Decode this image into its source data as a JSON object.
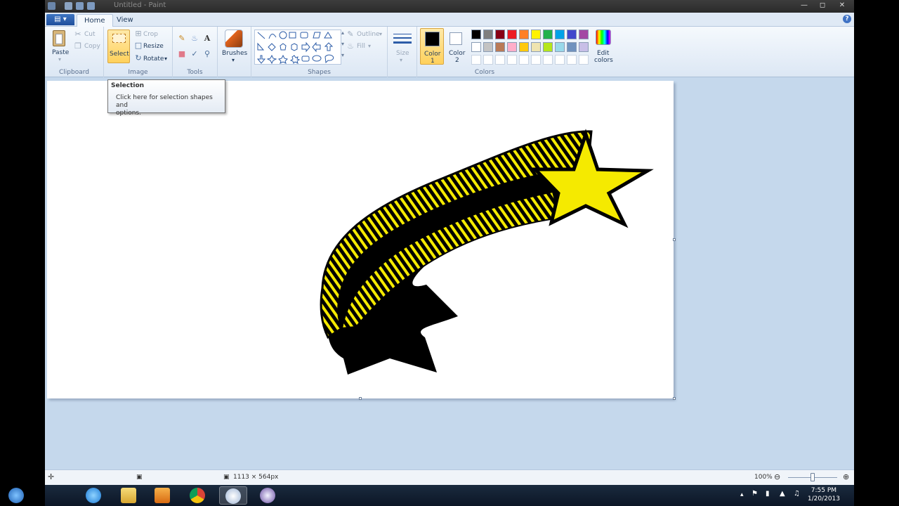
{
  "window": {
    "title": "Untitled - Paint"
  },
  "tabs": [
    {
      "label": "Home",
      "active": true
    },
    {
      "label": "View",
      "active": false
    }
  ],
  "ribbon": {
    "clipboard": {
      "group_label": "Clipboard",
      "paste": "Paste",
      "cut": "Cut",
      "copy": "Copy"
    },
    "image": {
      "group_label": "Image",
      "select": "Select",
      "crop": "Crop",
      "resize": "Resize",
      "rotate": "Rotate"
    },
    "tools": {
      "group_label": "Tools"
    },
    "brushes": {
      "label": "Brushes"
    },
    "shapes": {
      "group_label": "Shapes",
      "outline": "Outline",
      "fill": "Fill"
    },
    "size": {
      "label": "Size"
    },
    "colors": {
      "group_label": "Colors",
      "color1": {
        "label": "Color",
        "num": "1",
        "value": "#000000"
      },
      "color2": {
        "label": "Color",
        "num": "2",
        "value": "#ffffff"
      },
      "edit": {
        "line1": "Edit",
        "line2": "colors"
      },
      "palette_row1": [
        "#000000",
        "#7f7f7f",
        "#880015",
        "#ed1c24",
        "#ff7f27",
        "#fff200",
        "#22b14c",
        "#00a2e8",
        "#3f48cc",
        "#a349a4"
      ],
      "palette_row2": [
        "#ffffff",
        "#c3c3c3",
        "#b97a57",
        "#ffaec9",
        "#ffc90e",
        "#efe4b0",
        "#b5e61d",
        "#99d9ea",
        "#7092be",
        "#c8bfe7"
      ]
    }
  },
  "tooltip": {
    "title": "Selection",
    "body_line1": "Click here for selection shapes and",
    "body_line2": "options."
  },
  "status": {
    "canvas_size": "1113 × 564px",
    "zoom": "100%"
  },
  "canvas": {
    "accent_yellow": "#f5ea00",
    "ink": "#000000"
  },
  "taskbar": {
    "time": "7:55 PM",
    "date": "1/20/2013"
  }
}
